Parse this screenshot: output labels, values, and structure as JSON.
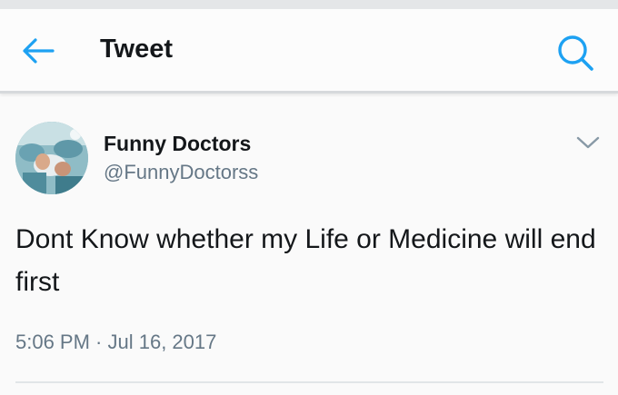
{
  "header": {
    "title": "Tweet",
    "back_icon": "back-arrow-icon",
    "search_icon": "search-icon"
  },
  "tweet": {
    "author_name": "Funny Doctors",
    "author_handle": "@FunnyDoctorss",
    "text": "Dont Know whether my Life or Medicine will end first",
    "timestamp": "5:06 PM · Jul 16, 2017",
    "menu_icon": "chevron-down-icon"
  },
  "colors": {
    "accent": "#1da1f2",
    "primary_text": "#14171a",
    "secondary_text": "#657786",
    "divider": "#e1e5e8",
    "background": "#fafafa"
  }
}
